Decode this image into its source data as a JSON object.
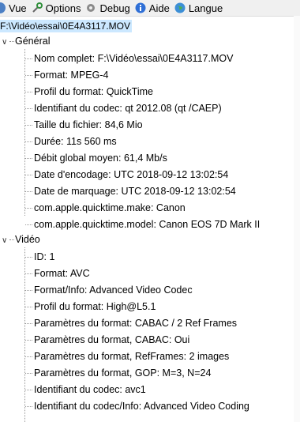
{
  "menu": [
    {
      "label": "Vue",
      "icon": "eye-icon"
    },
    {
      "label": "Options",
      "icon": "wrench-icon"
    },
    {
      "label": "Debug",
      "icon": "gear-icon"
    },
    {
      "label": "Aide",
      "icon": "info-icon"
    },
    {
      "label": "Langue",
      "icon": "globe-icon"
    }
  ],
  "tree": {
    "root": "F:\\Vidéo\\essai\\0E4A3117.MOV",
    "general": {
      "title": "Général",
      "items": [
        "Nom complet: F:\\Vidéo\\essai\\0E4A3117.MOV",
        "Format: MPEG-4",
        "Profil du format: QuickTime",
        "Identifiant du codec: qt   2012.08 (qt  /CAEP)",
        "Taille du fichier: 84,6 Mio",
        "Durée: 11s 560 ms",
        "Débit global moyen: 61,4 Mb/s",
        "Date d'encodage: UTC 2018-09-12 13:02:54",
        "Date de marquage: UTC 2018-09-12 13:02:54",
        "com.apple.quicktime.make: Canon",
        "com.apple.quicktime.model: Canon EOS 7D Mark II"
      ]
    },
    "video": {
      "title": "Vidéo",
      "items": [
        "ID: 1",
        "Format: AVC",
        "Format/Info: Advanced Video Codec",
        "Profil du format: High@L5.1",
        "Paramètres du format: CABAC / 2 Ref Frames",
        "Paramètres du format, CABAC: Oui",
        "Paramètres du format, RefFrames: 2 images",
        "Paramètres du format, GOP: M=3, N=24",
        "Identifiant du codec: avc1",
        "Identifiant du codec/Info: Advanced Video Coding"
      ]
    }
  }
}
